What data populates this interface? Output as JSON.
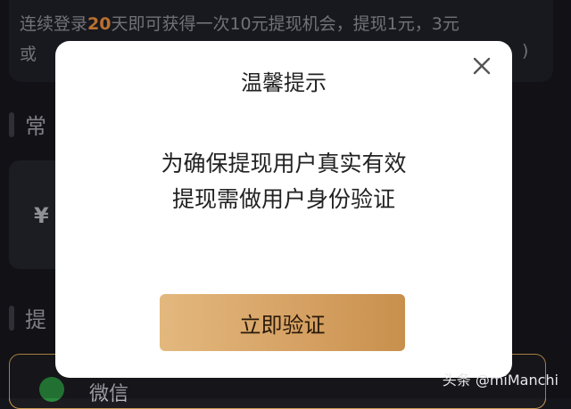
{
  "notice": {
    "line1_prefix": "连续登录",
    "line1_highlight": "20",
    "line1_suffix": "天即可获得一次10元提现机会，提现1元，3元",
    "line2_start": "或",
    "line2_end": ")"
  },
  "sections": {
    "regular_title": "常",
    "withdraw_title": "提"
  },
  "amount_card": {
    "text": "¥"
  },
  "payment": {
    "wechat_label": "微信"
  },
  "dialog": {
    "title": "温馨提示",
    "message_line1": "为确保提现用户真实有效",
    "message_line2": "提现需做用户身份验证",
    "verify_button": "立即验证",
    "close_icon": "close-icon"
  },
  "watermark": "头条 @miManchi",
  "colors": {
    "highlight": "#e28a3a",
    "button_gradient_start": "#e3b87e",
    "button_gradient_end": "#c8904c",
    "wechat_green": "#2a8a3e"
  }
}
